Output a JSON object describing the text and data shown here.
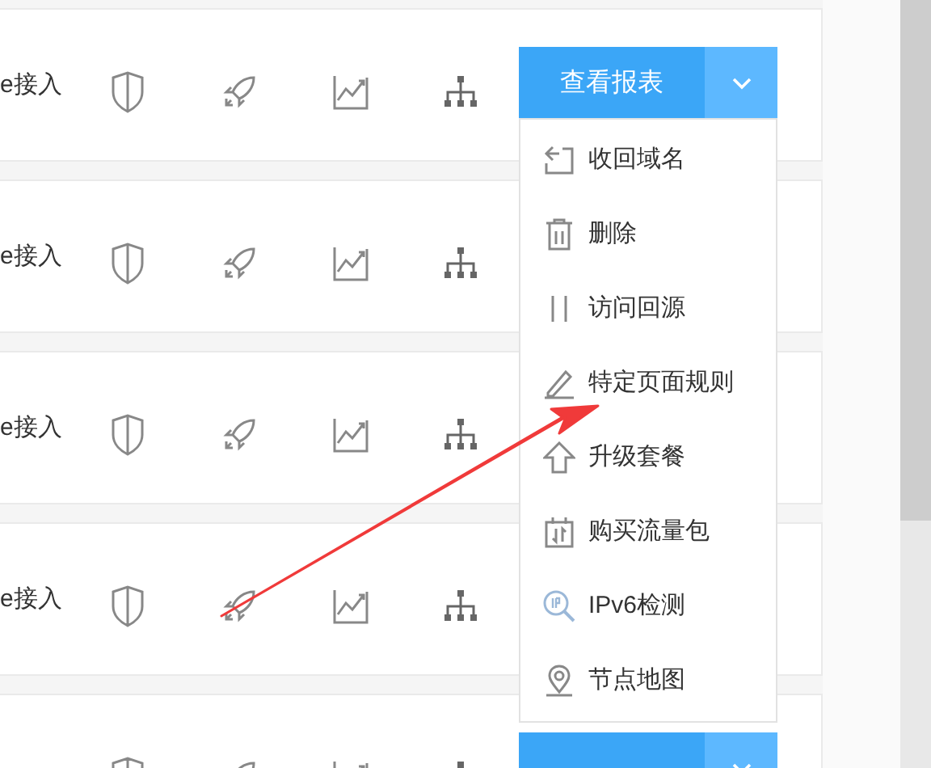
{
  "rows": [
    {
      "kind": "full",
      "label": "e接入",
      "button": "查看报表"
    },
    {
      "kind": "full",
      "label": "e接入"
    },
    {
      "kind": "full",
      "label": "e接入"
    },
    {
      "kind": "full",
      "label": "e接入"
    },
    {
      "kind": "cut"
    }
  ],
  "menu": {
    "items": [
      {
        "kind": "reclaim",
        "label": "收回域名"
      },
      {
        "kind": "delete",
        "label": "删除"
      },
      {
        "kind": "origin",
        "label": "访问回源"
      },
      {
        "kind": "rule",
        "label": "特定页面规则"
      },
      {
        "kind": "upgrade",
        "label": "升级套餐"
      },
      {
        "kind": "traffic",
        "label": "购买流量包"
      },
      {
        "kind": "ipv6",
        "label": "IPv6检测"
      },
      {
        "kind": "map",
        "label": "节点地图"
      }
    ]
  }
}
